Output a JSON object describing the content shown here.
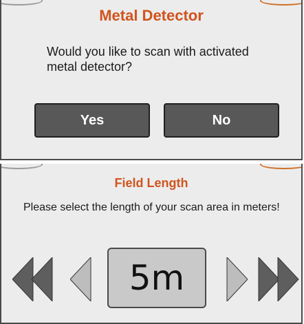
{
  "metal_dialog": {
    "title": "Metal Detector",
    "question": "Would you like to scan with activated metal detector?",
    "yes_label": "Yes",
    "no_label": "No"
  },
  "field_dialog": {
    "title": "Field Length",
    "description": "Please select the length of your scan area in meters!",
    "value": "5m"
  },
  "colors": {
    "title": "#d0541e",
    "button_bg": "#585858",
    "arrow_dark": "#5e5e5e",
    "arrow_light": "#bdbdbd"
  }
}
